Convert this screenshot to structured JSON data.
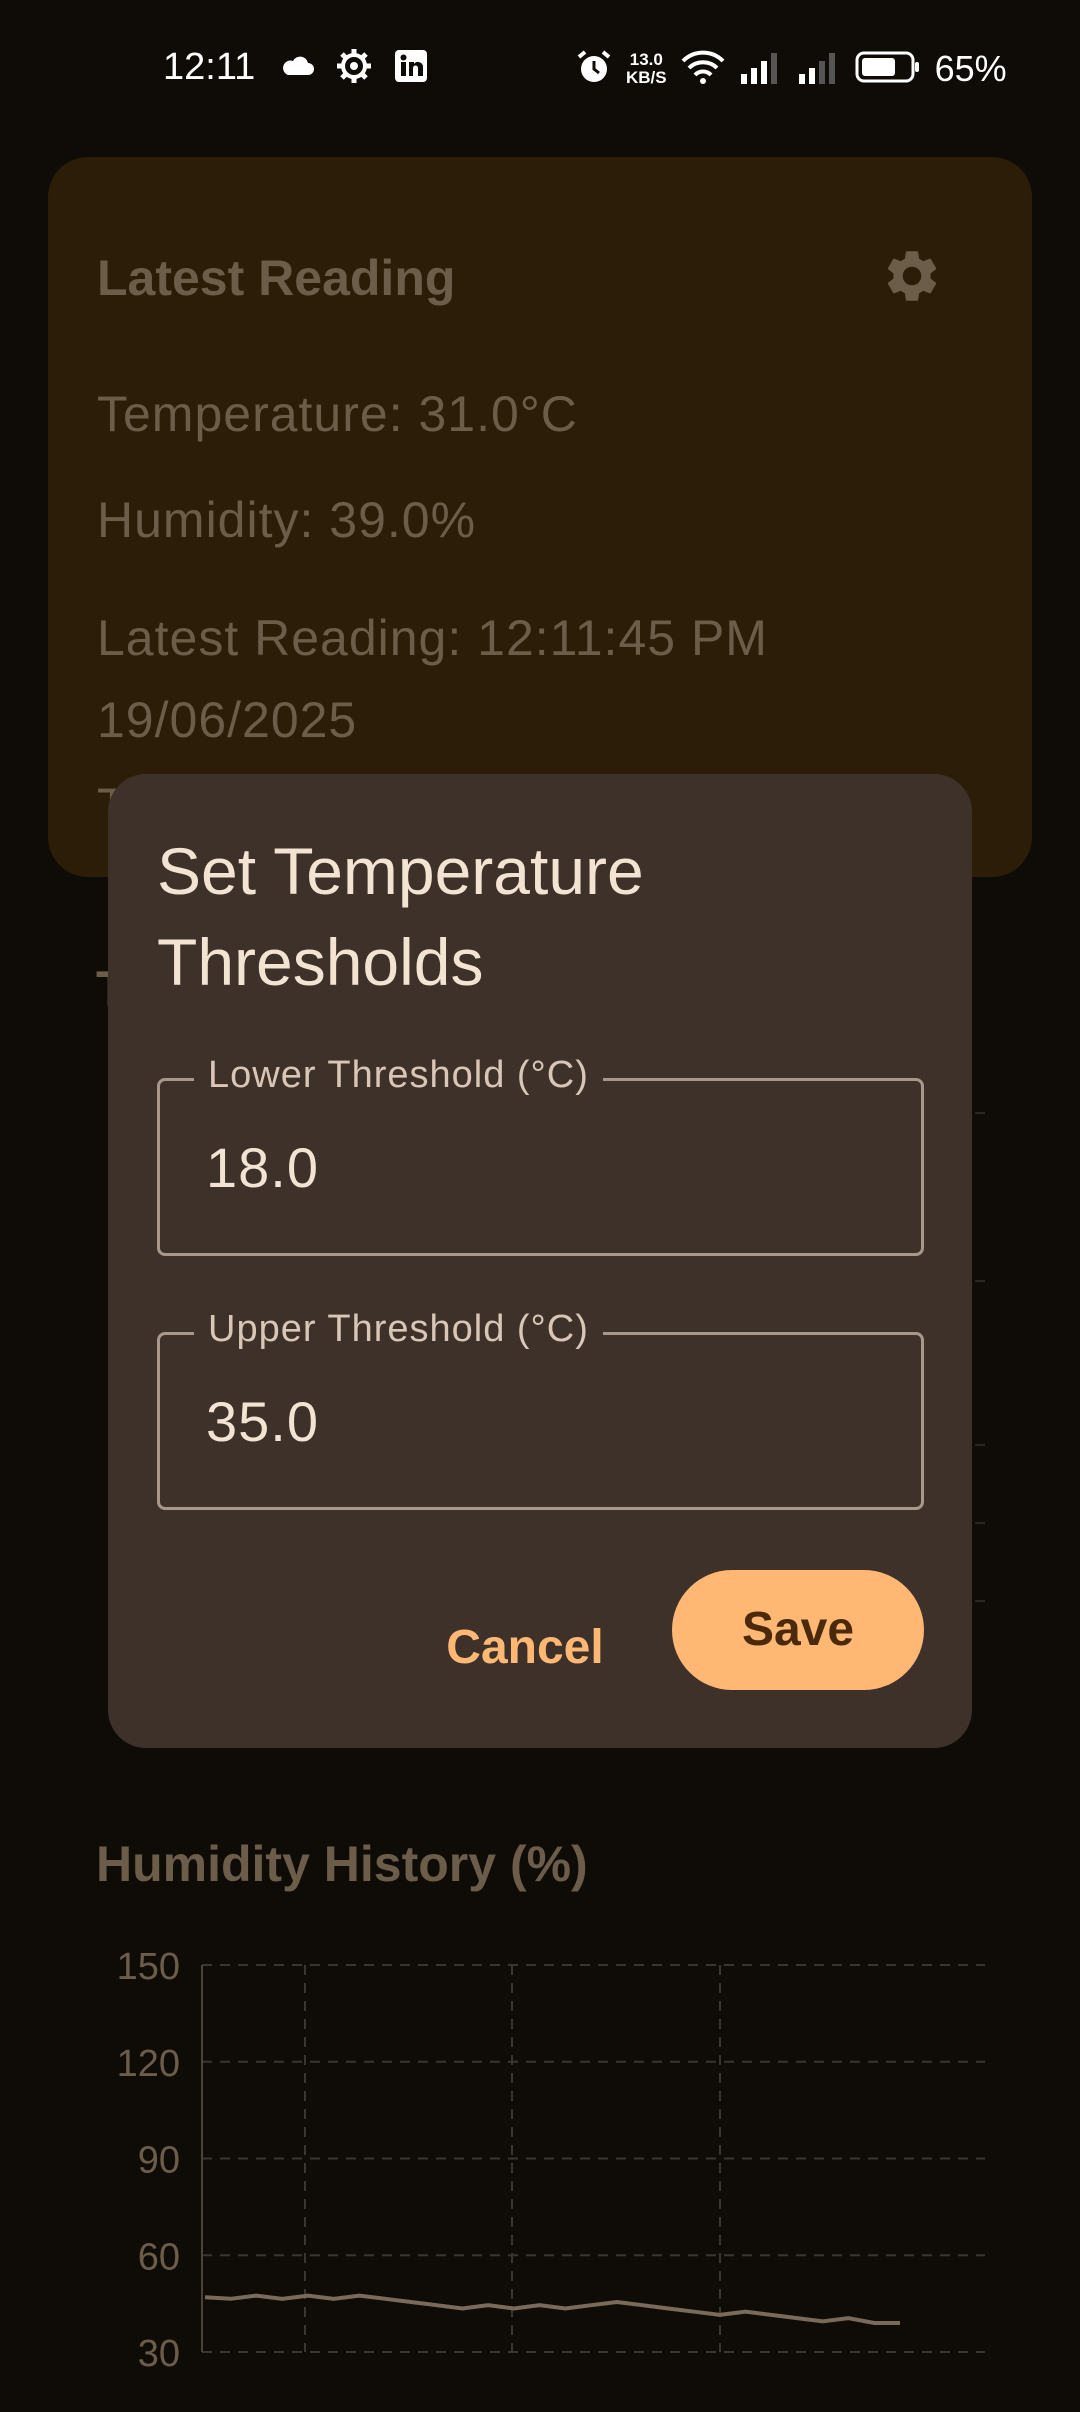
{
  "status_bar": {
    "time": "12:11",
    "net_speed_value": "13.0",
    "net_speed_unit": "KB/S",
    "battery": "65%",
    "icons": [
      "cloud-icon",
      "settings-icon",
      "linkedin-icon",
      "alarm-icon",
      "wifi-icon",
      "signal-icon",
      "signal-icon",
      "battery-icon"
    ]
  },
  "latest_card": {
    "title": "Latest Reading",
    "temperature": "Temperature: 31.0°C",
    "humidity": "Humidity: 39.0%",
    "reading_time": "Latest Reading: 12:11:45 PM 19/06/2025",
    "cut_text": "T"
  },
  "temperature_section": {
    "title_fragment": "T"
  },
  "dialog": {
    "title": "Set Temperature Thresholds",
    "lower_label": "Lower Threshold (°C)",
    "lower_value": "18.0",
    "upper_label": "Upper Threshold (°C)",
    "upper_value": "35.0",
    "cancel_label": "Cancel",
    "save_label": "Save"
  },
  "humidity_section": {
    "title": "Humidity History (%)"
  },
  "chart_data": {
    "type": "line",
    "title": "Humidity History (%)",
    "yticks": [
      "150",
      "120",
      "90",
      "60",
      "30"
    ],
    "ylim": [
      30,
      150
    ],
    "grid": true,
    "series": [
      {
        "values": [
          47,
          46.5,
          47.5,
          46.5,
          47.5,
          46.5,
          47.5,
          46.5,
          45.5,
          44.5,
          43.5,
          44.5,
          43.5,
          44.5,
          43.5,
          44.5,
          45.5,
          44.5,
          43.5,
          42.5,
          41.5,
          42.5,
          41.5,
          40.5,
          39.5,
          40.5,
          39,
          39
        ]
      }
    ],
    "colors": {
      "line": "#7a6a5a",
      "grid": "#3a3530",
      "text": "#6c5c4a"
    }
  }
}
